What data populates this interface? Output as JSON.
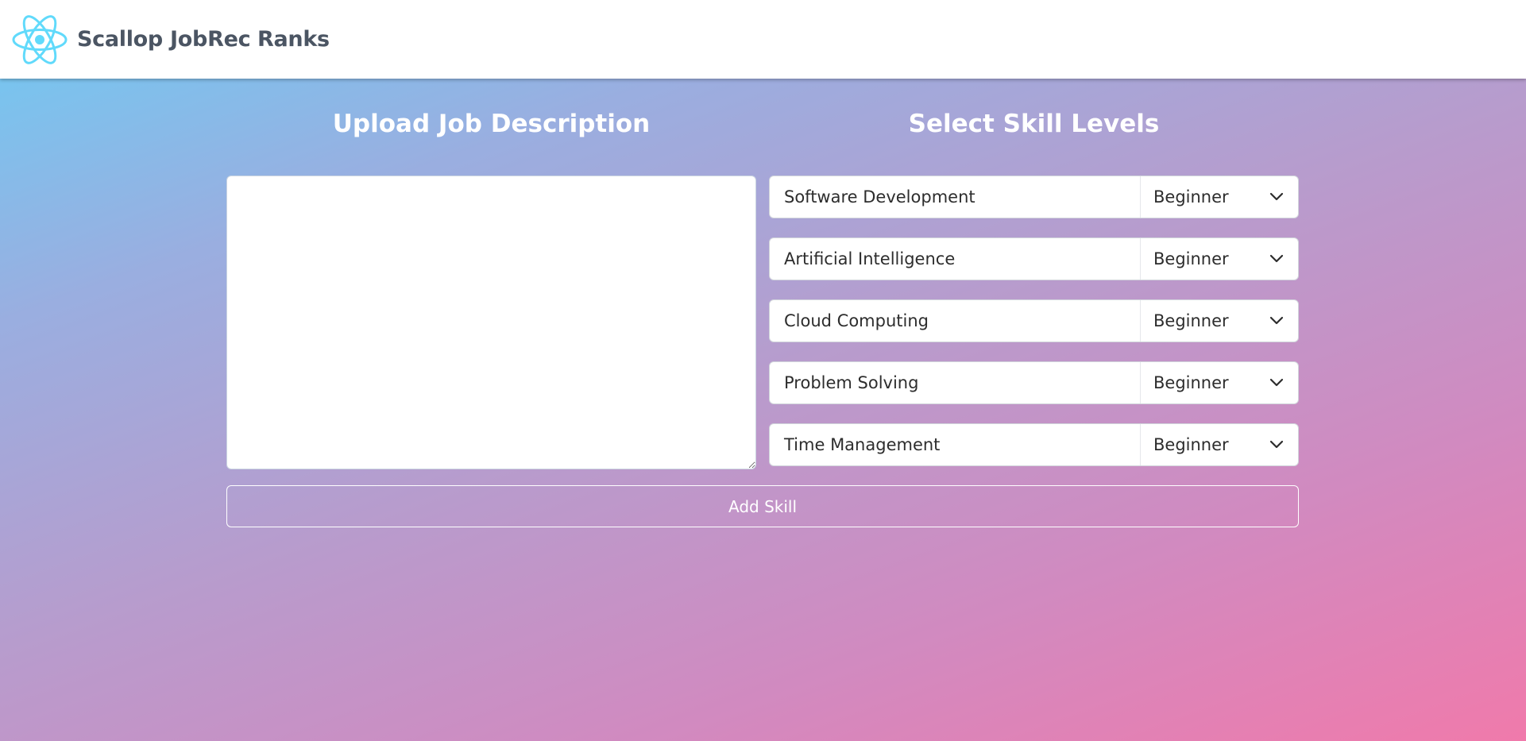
{
  "app": {
    "brand": "Scallop JobRec",
    "logo_icon": "react-atom-icon",
    "accent_color": "#61dafb"
  },
  "nav": {
    "items": [
      {
        "label": "Ranks"
      }
    ]
  },
  "left_panel": {
    "heading": "Upload Job Description",
    "textarea_value": "",
    "textarea_placeholder": ""
  },
  "right_panel": {
    "heading": "Select Skill Levels",
    "skills": [
      {
        "name": "Software Development",
        "level": "Beginner"
      },
      {
        "name": "Artificial Intelligence",
        "level": "Beginner"
      },
      {
        "name": "Cloud Computing",
        "level": "Beginner"
      },
      {
        "name": "Problem Solving",
        "level": "Beginner"
      },
      {
        "name": "Time Management",
        "level": "Beginner"
      }
    ],
    "level_icon": "chevron-down-icon"
  },
  "actions": {
    "add_skill_label": "Add Skill"
  }
}
